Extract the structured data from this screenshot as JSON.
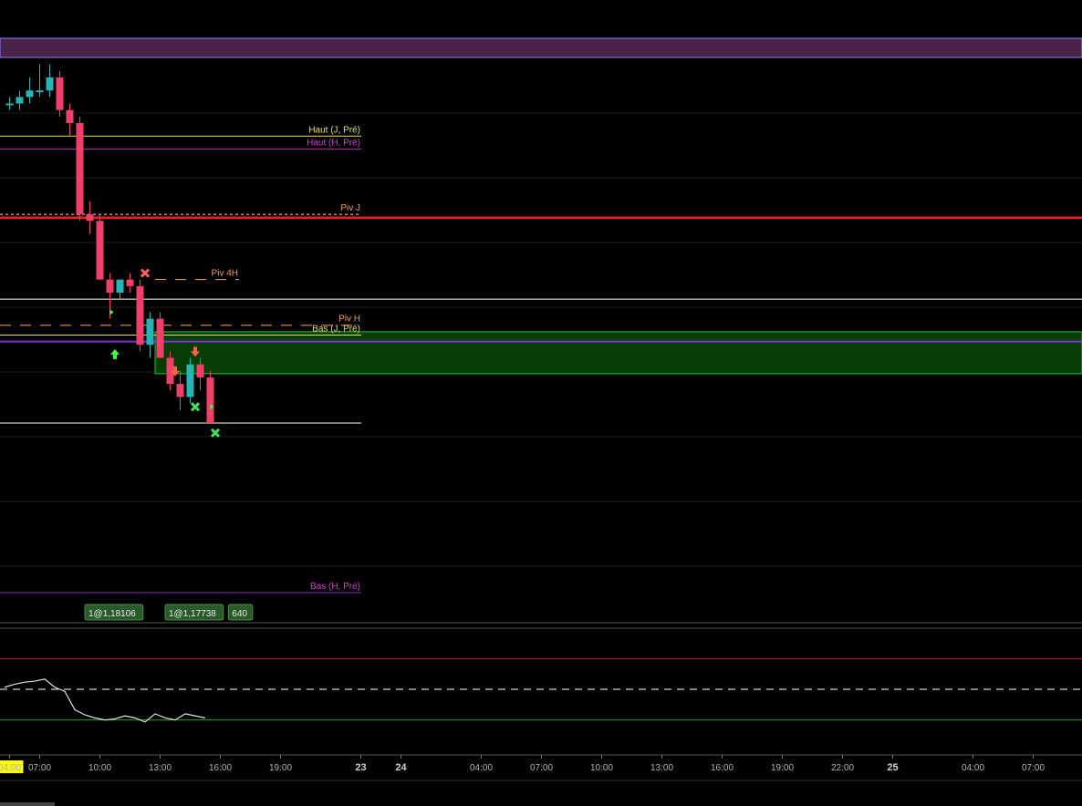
{
  "chart_data": {
    "type": "candlestick",
    "y_scale": {
      "top_price": 1.1855,
      "bottom_price": 1.1705,
      "note_units": "EUR/USD price"
    },
    "bullish_color": "#26b5b5",
    "bearish_color": "#f0406a",
    "x_axis": {
      "ticks": [
        {
          "label": "04:00",
          "slot": 0,
          "highlight": true
        },
        {
          "label": "07:00",
          "slot": 3
        },
        {
          "label": "10:00",
          "slot": 9
        },
        {
          "label": "13:00",
          "slot": 15
        },
        {
          "label": "16:00",
          "slot": 21
        },
        {
          "label": "19:00",
          "slot": 27
        },
        {
          "label": "23",
          "slot": 35,
          "bold": true
        },
        {
          "label": "24",
          "slot": 39,
          "bold": true
        },
        {
          "label": "04:00",
          "slot": 47
        },
        {
          "label": "07:00",
          "slot": 53
        },
        {
          "label": "10:00",
          "slot": 59
        },
        {
          "label": "13:00",
          "slot": 65
        },
        {
          "label": "16:00",
          "slot": 71
        },
        {
          "label": "19:00",
          "slot": 77
        },
        {
          "label": "22:00",
          "slot": 83
        },
        {
          "label": "25",
          "slot": 88,
          "bold": true
        },
        {
          "label": "04:00",
          "slot": 96
        },
        {
          "label": "07:00",
          "slot": 102
        }
      ]
    },
    "candles": [
      {
        "o": 1.1845,
        "h": 1.1846,
        "l": 1.1844,
        "c": 1.1845
      },
      {
        "o": 1.1845,
        "h": 1.1847,
        "l": 1.1844,
        "c": 1.1846
      },
      {
        "o": 1.1846,
        "h": 1.1849,
        "l": 1.1845,
        "c": 1.1847
      },
      {
        "o": 1.1847,
        "h": 1.1851,
        "l": 1.1846,
        "c": 1.1847
      },
      {
        "o": 1.1847,
        "h": 1.1851,
        "l": 1.1846,
        "c": 1.1849
      },
      {
        "o": 1.1849,
        "h": 1.185,
        "l": 1.1843,
        "c": 1.1844
      },
      {
        "o": 1.1844,
        "h": 1.1845,
        "l": 1.184,
        "c": 1.1842
      },
      {
        "o": 1.1842,
        "h": 1.1843,
        "l": 1.1827,
        "c": 1.1828
      },
      {
        "o": 1.1828,
        "h": 1.183,
        "l": 1.1825,
        "c": 1.1827
      },
      {
        "o": 1.1827,
        "h": 1.1828,
        "l": 1.1818,
        "c": 1.1818
      },
      {
        "o": 1.1818,
        "h": 1.1819,
        "l": 1.1812,
        "c": 1.1816
      },
      {
        "o": 1.1816,
        "h": 1.1818,
        "l": 1.1815,
        "c": 1.1818
      },
      {
        "o": 1.1818,
        "h": 1.1819,
        "l": 1.1816,
        "c": 1.1817
      },
      {
        "o": 1.1817,
        "h": 1.1818,
        "l": 1.1807,
        "c": 1.1808
      },
      {
        "o": 1.1808,
        "h": 1.1813,
        "l": 1.1806,
        "c": 1.1812
      },
      {
        "o": 1.1812,
        "h": 1.1813,
        "l": 1.1806,
        "c": 1.1806
      },
      {
        "o": 1.1806,
        "h": 1.1807,
        "l": 1.1801,
        "c": 1.1802
      },
      {
        "o": 1.1802,
        "h": 1.1804,
        "l": 1.1798,
        "c": 1.18
      },
      {
        "o": 1.18,
        "h": 1.1806,
        "l": 1.1799,
        "c": 1.1805
      },
      {
        "o": 1.1805,
        "h": 1.1806,
        "l": 1.1801,
        "c": 1.1803
      },
      {
        "o": 1.1803,
        "h": 1.1804,
        "l": 1.1796,
        "c": 1.1796
      }
    ],
    "horizontal_levels": [
      {
        "label": "Haut (J, Pré)",
        "price": 1.184,
        "color": "#e8e050",
        "style": "solid",
        "width": 1,
        "span": "short",
        "label_color": "#e8e050"
      },
      {
        "label": "Haut (H, Pré)",
        "price": 1.1838,
        "color": "#b030b0",
        "style": "solid",
        "width": 1,
        "span": "short",
        "label_color": "#d040d0"
      },
      {
        "label": "Piv J",
        "price": 1.1828,
        "color": "#e0e0e0",
        "style": "dotted",
        "width": 1,
        "span": "short",
        "label_color": "#f0a050"
      },
      {
        "label": "",
        "price": 1.18275,
        "color": "#ff1a1a",
        "style": "solid",
        "width": 2.5,
        "span": "full",
        "label_color": ""
      },
      {
        "label": "Piv 4H",
        "price": 1.1818,
        "color": "#f0a050",
        "style": "longdash",
        "width": 1,
        "span": "pivot4h",
        "label_color": "#f0a050"
      },
      {
        "label": "",
        "price": 1.1815,
        "color": "#ffffff",
        "style": "solid",
        "width": 1,
        "span": "full",
        "label_color": ""
      },
      {
        "label": "Piv H",
        "price": 1.1811,
        "color": "#f0a050",
        "style": "longdash",
        "width": 1,
        "span": "short",
        "label_color": "#f0a050"
      },
      {
        "label": "Bas (J, Pré)",
        "price": 1.18095,
        "color": "#e8e050",
        "style": "solid",
        "width": 1,
        "span": "short",
        "label_color": "#e8e050"
      },
      {
        "label": "",
        "price": 1.18085,
        "color": "#8030d0",
        "style": "solid",
        "width": 2,
        "span": "full",
        "label_color": ""
      },
      {
        "label": "",
        "price": 1.1796,
        "color": "#ffffff",
        "style": "solid",
        "width": 1,
        "span": "short",
        "label_color": ""
      },
      {
        "label": "Bas (H, Pré)",
        "price": 1.177,
        "color": "#9030b0",
        "style": "solid",
        "width": 1,
        "span": "short",
        "label_color": "#d040d0"
      }
    ],
    "zones": [
      {
        "from_price": 1.1855,
        "to_price": 1.1853,
        "fill": "#4a2448",
        "border": "#8a80ff"
      },
      {
        "from_price": 1.181,
        "to_price": 1.1805,
        "fill": "#053d05",
        "border": "#20c040",
        "from_slot": 15
      }
    ],
    "markers": [
      {
        "type": "x",
        "slot": 13.5,
        "price": 1.1819,
        "color": "#ff6060"
      },
      {
        "type": "arrow-up",
        "slot": 10.5,
        "price": 1.18065,
        "color": "#40ff40"
      },
      {
        "type": "arrow-down",
        "slot": 16.5,
        "price": 1.1804,
        "color": "#ff6040"
      },
      {
        "type": "arrow-down",
        "slot": 18.5,
        "price": 1.1807,
        "color": "#ff6040"
      },
      {
        "type": "x",
        "slot": 18.5,
        "price": 1.17985,
        "color": "#40e060"
      },
      {
        "type": "x",
        "slot": 20.5,
        "price": 1.17945,
        "color": "#40e060"
      },
      {
        "type": "tri-right",
        "slot": 10,
        "price": 1.1813,
        "color": "#40ff40"
      },
      {
        "type": "tri-right",
        "slot": 20,
        "price": 1.17985,
        "color": "#40ff40"
      }
    ],
    "order_labels": [
      {
        "text": "1@1,18106",
        "slot": 8
      },
      {
        "text": "1@1,17738",
        "slot": 16
      },
      {
        "text": "640",
        "slot": 22.3
      }
    ],
    "oscillator": {
      "upper_line_color": "#c02020",
      "lower_line_color": "#20a020",
      "mid_line": "dashed",
      "min": 0,
      "max": 100,
      "upper": 80,
      "lower": 20,
      "values": [
        52,
        55,
        57,
        58,
        60,
        52,
        48,
        30,
        25,
        22,
        20,
        21,
        24,
        22,
        18,
        26,
        22,
        20,
        26,
        24,
        22
      ]
    }
  }
}
